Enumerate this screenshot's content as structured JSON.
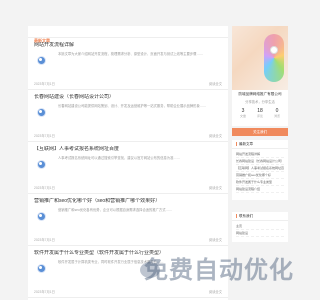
{
  "main": {
    "section_title": "最新文章",
    "articles": [
      {
        "title": "网站开发流程详解",
        "desc": "本篇文章为大家介绍网站开发流程，梳理需求分析、原型设计、页面开发与测试上线等主要步骤……",
        "date": "2023年7月1日",
        "more": "阅读全文"
      },
      {
        "title": "长春网站建设（长春网站设计公司）",
        "desc": "长春网站建设公司能提供网站策划、设计、开发及运营维护等一站式服务，帮助企业展示品牌形象……",
        "date": "2023年7月1日",
        "more": "阅读全文"
      },
      {
        "title": "【互联网】人事考试报名系统网址百度",
        "desc": "人事考试报名系统网址可以通过搜索引擎查找，建议以官方网站公布的信息为准……",
        "date": "2023年7月1日",
        "more": "阅读全文"
      },
      {
        "title": "营销推广和seo优化哪个好（seo和营销推广哪个效果好）",
        "desc": "营销推广和seo优化各有优势，企业可以根据自身需求选择合适的推广方式……",
        "date": "2023年7月1日",
        "more": "阅读全文"
      },
      {
        "title": "软件开发属于什么专业类型（软件开发属于什么行业类型）",
        "desc": "软件开发属于计算机类专业，同时软件开发行业属于信息技术服务业……",
        "date": "2023年7月1日",
        "more": "阅读全文"
      }
    ]
  },
  "profile": {
    "brand": "防城品牌网络推广有限公司",
    "tagline": "分享技术，分享生活",
    "stats": [
      {
        "num": "3",
        "label": "文章"
      },
      {
        "num": "18",
        "label": "评论"
      },
      {
        "num": "0",
        "label": "浏览"
      }
    ],
    "follow_label": "关注我们",
    "colors": {
      "accent": "#f08a5d"
    }
  },
  "hot": {
    "title": "最新文章",
    "items": [
      "网站开发流程详解",
      "长春网站建设（长春网站设计公司）",
      "【互联网】人事考试报名系统网址百度",
      "营销推广和seo优化哪个好",
      "软件开发属于什么专业类型",
      "网站建设流程介绍"
    ]
  },
  "visit": {
    "title": "联系我们",
    "items": [
      "主页",
      "网站建设"
    ]
  },
  "watermark": {
    "text": "免费自动优化"
  }
}
